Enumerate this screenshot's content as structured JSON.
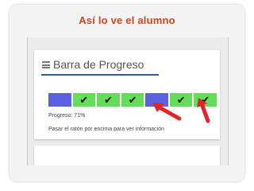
{
  "slide": {
    "title": "Así lo ve el alumno"
  },
  "card": {
    "title": "Barra de Progreso",
    "segments": [
      {
        "state": "pending",
        "mark": ""
      },
      {
        "state": "done",
        "mark": "✔"
      },
      {
        "state": "done",
        "mark": "✔"
      },
      {
        "state": "done",
        "mark": "✔"
      },
      {
        "state": "pending",
        "mark": ""
      },
      {
        "state": "done",
        "mark": "✔"
      },
      {
        "state": "done",
        "mark": "✔"
      }
    ],
    "progress_text": "Progreso: 71%",
    "hint_text": "Pasar el ratón por encima para ver información"
  },
  "colors": {
    "title": "#d6411d",
    "pending": "#5a62e0",
    "done": "#66dd5a",
    "arrow": "#e0262a",
    "underline": "#2b5f9e"
  },
  "icons": {
    "menu": "hamburger-icon",
    "done_mark": "check-icon",
    "annotation": "red-arrow"
  }
}
